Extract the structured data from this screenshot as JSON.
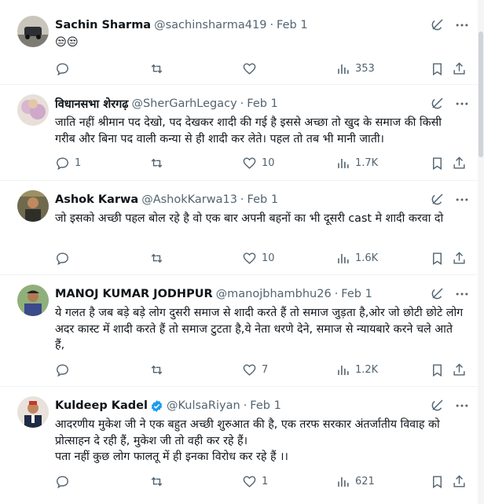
{
  "tweets": [
    {
      "name": "Sachin Sharma",
      "handle": "@sachinsharma419",
      "sep": "·",
      "date": "Feb 1",
      "text": "😒😒",
      "replies": "",
      "retweets": "",
      "likes": "",
      "views": "353",
      "verified": false
    },
    {
      "name": "विधानसभा शेरगढ़",
      "handle": "@SherGarhLegacy",
      "sep": "·",
      "date": "Feb 1",
      "text": "जाति नहीं श्रीमान पद देखो, पद देखकर शादी की गई है इससे अच्छा तो खुद के समाज की किसी गरीब और बिना पद वाली कन्या से ही शादी कर लेते। पहल तो तब भी मानी जाती।",
      "replies": "1",
      "retweets": "",
      "likes": "10",
      "views": "1.7K",
      "verified": false
    },
    {
      "name": "Ashok Karwa",
      "handle": "@AshokKarwa13",
      "sep": "·",
      "date": "Feb 1",
      "text": "जो इसको अच्छी पहल बोल रहे है वो एक बार अपनी बहनों का भी दूसरी cast मे शादी करवा दो",
      "replies": "",
      "retweets": "",
      "likes": "10",
      "views": "1.6K",
      "verified": false
    },
    {
      "name": "MANOJ KUMAR JODHPUR",
      "handle": "@manojbhambhu26",
      "sep": "·",
      "date": "Feb 1",
      "text": "ये गलत है जब बड़े बड़े लोग दुसरी समाज से शादी करते हैं तो समाज जुड़ता है,ओर जो छोटी छोटे लोग अदर कास्ट में शादी करते हैं तो समाज टुटता है,ये नेता धरणे देने, समाज से न्यायबारे करने चले आते हैं,",
      "replies": "",
      "retweets": "",
      "likes": "7",
      "views": "1.2K",
      "verified": false
    },
    {
      "name": "Kuldeep Kadel",
      "handle": "@KulsaRiyan",
      "sep": "·",
      "date": "Feb 1",
      "text": "आदरणीय मुकेश जी ने एक बहुत अच्छी शुरुआत की है, एक तरफ सरकार अंतर्जातीय विवाह को प्रोत्साहन दे रही हैं, मुकेश जी तो वही कर रहे हैं।\nपता नहीं कुछ लोग फालतू में ही इनका विरोध कर रहे हैं ।।",
      "replies": "",
      "retweets": "",
      "likes": "1",
      "views": "621",
      "verified": true
    }
  ],
  "icons": {
    "reply": "reply-icon",
    "retweet": "retweet-icon",
    "like": "like-icon",
    "views": "views-icon",
    "bookmark": "bookmark-icon",
    "share": "share-icon",
    "grok": "grok-icon",
    "more": "more-icon"
  },
  "colors": {
    "text": "#0f1419",
    "secondary": "#536471",
    "verified": "#1d9bf0",
    "divider": "#eff3f4"
  }
}
